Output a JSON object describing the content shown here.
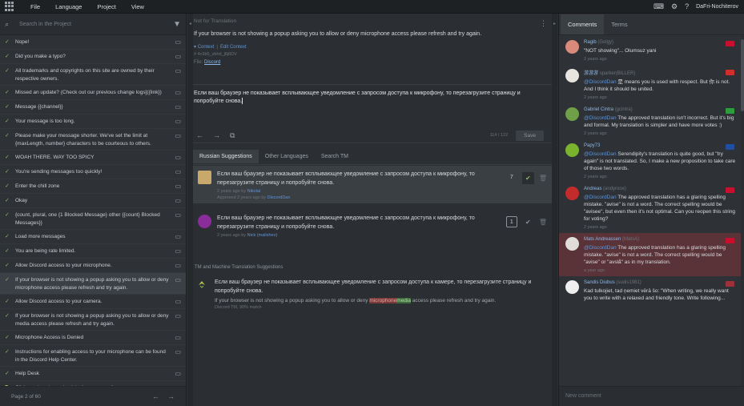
{
  "menu": {
    "file": "File",
    "language": "Language",
    "project": "Project",
    "view": "View"
  },
  "user": {
    "name": "DaFri-Nochiterov"
  },
  "left": {
    "search_placeholder": "Search in the Project",
    "strings": [
      {
        "text": "Nope!",
        "state": "check"
      },
      {
        "text": "Did you make a typo?",
        "state": "check"
      },
      {
        "text": "All trademarks and copyrights on this site are owned by their respective owners.",
        "state": "check"
      },
      {
        "text": "Missed an update? (Check out our previous change logs]({link})",
        "state": "check"
      },
      {
        "text": "Message {{channel}}",
        "state": "check"
      },
      {
        "text": "Your message is too long.",
        "state": "check"
      },
      {
        "text": "Please make your message shorter. We've set the limit at {maxLength, number} characters to be courteous to others.",
        "state": "check"
      },
      {
        "text": "WOAH THERE. WAY TOO SPICY",
        "state": "check"
      },
      {
        "text": "You're sending messages too quickly!",
        "state": "check"
      },
      {
        "text": "Enter the chill zone",
        "state": "check"
      },
      {
        "text": "Okay",
        "state": "check"
      },
      {
        "text": "{count, plural, one {1 Blocked Message} other {{count} Blocked Messages}}",
        "state": "check"
      },
      {
        "text": "Load more messages",
        "state": "check"
      },
      {
        "text": "You are being rate limited.",
        "state": "check"
      },
      {
        "text": "Allow Discord access to your microphone.",
        "state": "check"
      },
      {
        "text": "If your browser is not showing a popup asking you to allow or deny microphone access please refresh and try again.",
        "state": "check",
        "active": true
      },
      {
        "text": "Allow Discord access to your camera.",
        "state": "check"
      },
      {
        "text": "If your browser is not showing a popup asking you to allow or deny media access please refresh and try again.",
        "state": "check"
      },
      {
        "text": "Microphone Access is Denied",
        "state": "check"
      },
      {
        "text": "Instructions for enabling access to your microphone can be found in the Discord Help Center.",
        "state": "check"
      },
      {
        "text": "Help Desk",
        "state": "check"
      },
      {
        "text": "Click a voice channel to join the conversation",
        "state": "square"
      }
    ],
    "pager": "Page 2 of 60"
  },
  "middle": {
    "hint": "Not for Translation",
    "source": "If your browser is not showing a popup asking you to allow or deny microphone access please refresh and try again.",
    "context_link": "Context",
    "edit_context_link": "Edit Context",
    "key": "# 4c9b5_vbhd_j6j6DV",
    "file_label": "File:",
    "file_name": "Discord",
    "translation": "Если ваш браузер не показывает всплывающее уведомление с запросом доступа к микрофону, то перезагрузите страницу и попробуйте снова.",
    "counter": "114 / 122",
    "save": "Save",
    "tabs": [
      "Russian Suggestions",
      "Other Languages",
      "Search TM"
    ],
    "suggestions": [
      {
        "text": "Если ваш браузер не показывает всплывающее уведомление с запросом доступа к микрофону, то перезагрузите страницу и попробуйте снова.",
        "meta_time": "2 years ago by",
        "meta_user": "Nikolai",
        "meta2": "Approved 2 years ago by",
        "meta2_user": "DiscordDan",
        "votes": "7"
      },
      {
        "text": "Если ваш браузер не показывает всплывающее уведомление с запросом доступа к микрофону, то перезагрузите страницу и попробуйте снова.",
        "meta_time": "2 years ago by",
        "meta_user": "Nick (malishev)",
        "votes": "1"
      }
    ],
    "tm_title": "TM and Machine Translation Suggestions",
    "tm": {
      "target": "Если ваш браузер не показывает всплывающее уведомление с запросом доступа к камере, то перезагрузите страницу и попробуйте снова.",
      "source_pre": "If your browser is not showing a popup asking you to allow or deny ",
      "source_del": "microphone",
      "source_ins": "media",
      "source_post": " access please refresh and try again.",
      "meta": "Discord TM, 90% match"
    }
  },
  "right": {
    "tabs": [
      "Comments",
      "Terms"
    ],
    "comments": [
      {
        "name": "Ragib",
        "handle": "(Golgy)",
        "text": "\"NOT showing\"... Olumsuz yani",
        "mention": "",
        "time": "2 years ago",
        "avatar": "#d98a7a",
        "flag": "#c8102e"
      },
      {
        "name": "游游游",
        "handle": "sparker(BILLER)",
        "mention": "@DiscordDan",
        "text": " 是 means you is used with respect. But 你 is not. And I think it should be united.",
        "time": "2 years ago",
        "avatar": "#e8e4e0",
        "flag": "#d22d2d"
      },
      {
        "name": "Gabriel Cintra",
        "handle": "(gcintra)",
        "mention": "@DiscordDan",
        "text": " The approved translation isn't incorrect. But it's big and formal. My translation is simpler and have more votes :)",
        "time": "2 years ago",
        "avatar": "#6fa048",
        "flag": "#2d9c3a"
      },
      {
        "name": "Papy73",
        "handle": "",
        "mention": "@DiscordDan",
        "text": " Serendipity's translation is quite good, but \"try again\" is not translated. So, I make a new proposition to take care of those two words.",
        "time": "2 years ago",
        "avatar": "#7ab32e",
        "flag": "#1f4fa3"
      },
      {
        "name": "Andreas",
        "handle": "(andyroox)",
        "mention": "@DiscordDan",
        "text": " The approved translation has a glaring spelling mistake. \"avise\" is not a word. The correct spelling would be \"avisee\", but even then it's not optimal. Can you reopen this string for voting?",
        "time": "2 years ago",
        "avatar": "#c42c2c",
        "flag": "#c8102e"
      },
      {
        "name": "Mats Andreassen",
        "handle": "(MatsA)",
        "mention": "@DiscordDan",
        "text": " The approved translation has a glaring spelling mistake. \"avise\" is not a word. The correct spelling would be \"avise\" or \"avslå\" as in my translation.",
        "time": "a year ago",
        "avatar": "#e0ddd8",
        "flag": "#c8102e",
        "highlight": true
      },
      {
        "name": "Sandis Diubus",
        "handle": "(sudis1981)",
        "mention": "",
        "text": "Kad tulkojiet, tad ņemiet vērā šo: \"When writing, we really want you to write with a relaxed and friendly tone. Write following...",
        "time": "",
        "avatar": "#efefef",
        "flag": "#9e3039"
      }
    ],
    "new_comment": "New comment"
  }
}
